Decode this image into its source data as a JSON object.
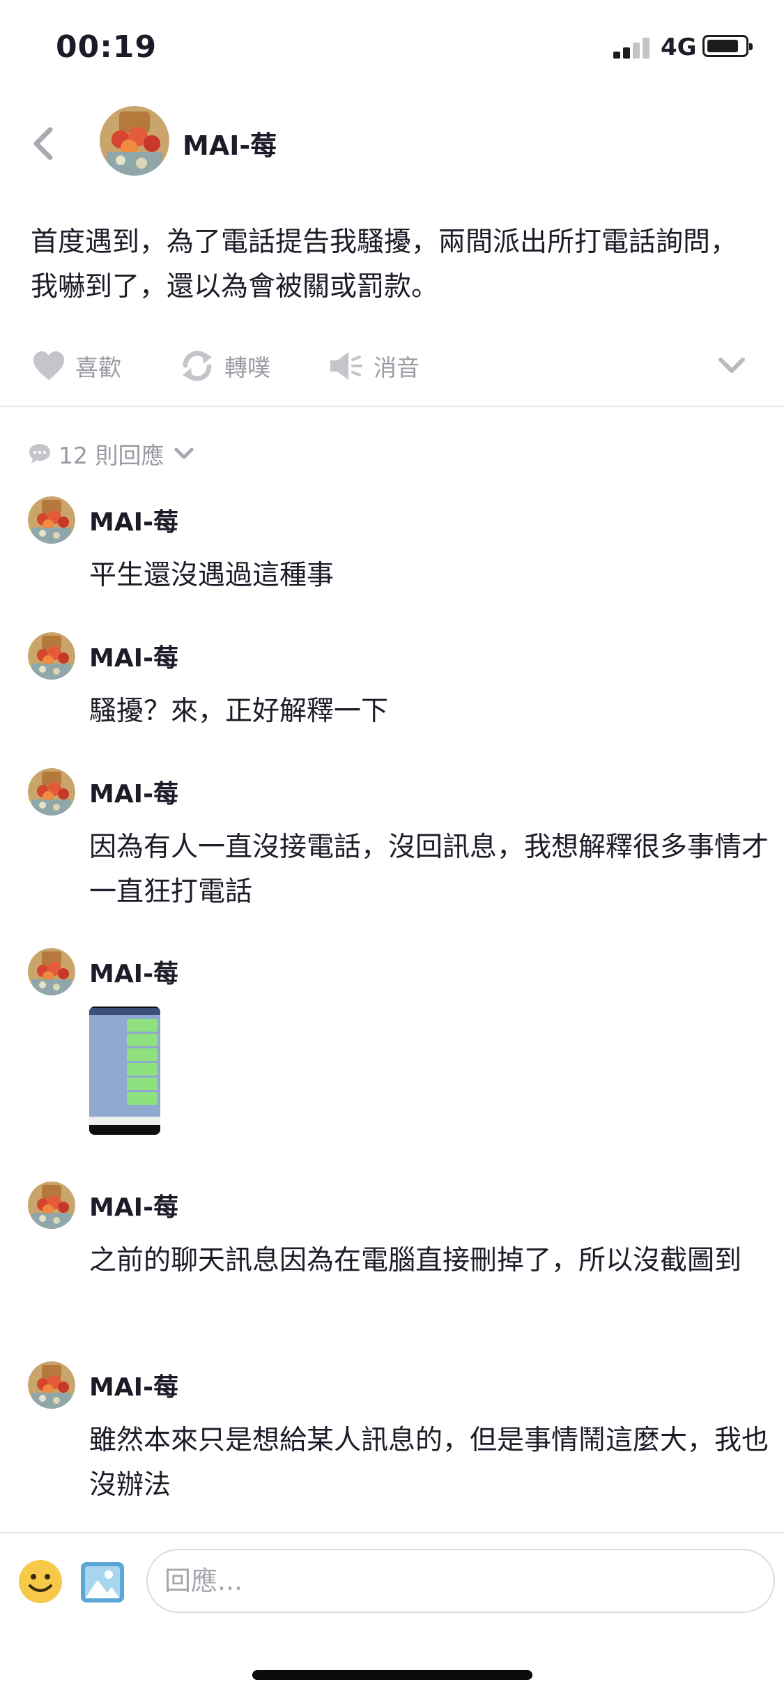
{
  "status_bar": {
    "time": "00:19",
    "network": "4G"
  },
  "header": {
    "name": "MAI-莓"
  },
  "post": {
    "text": "首度遇到，為了電話提告我騷擾，兩間派出所打電話詢問，我嚇到了，還以為會被關或罰款。"
  },
  "actions": {
    "like": "喜歡",
    "repost": "轉噗",
    "mute": "消音"
  },
  "replies": {
    "count_label": "12 則回應"
  },
  "comments": [
    {
      "name": "MAI-莓",
      "text": "平生還沒遇過這種事"
    },
    {
      "name": "MAI-莓",
      "text": "騷擾？來，正好解釋一下"
    },
    {
      "name": "MAI-莓",
      "text": "因為有人一直沒接電話，沒回訊息，我想解釋很多事情才一直狂打電話"
    },
    {
      "name": "MAI-莓",
      "text": ""
    },
    {
      "name": "MAI-莓",
      "text": "之前的聊天訊息因為在電腦直接刪掉了，所以沒截圖到"
    },
    {
      "name": "MAI-莓",
      "text": "雖然本來只是想給某人訊息的，但是事情鬧這麼大，我也沒辦法"
    }
  ],
  "composer": {
    "placeholder": "回應..."
  },
  "icons": {
    "back": "chevron-left-icon",
    "like": "heart-icon",
    "repost": "repost-icon",
    "mute": "speaker-mute-icon",
    "more": "chevron-down-icon",
    "comments": "speech-bubble-icon",
    "emoji": "smiley-icon",
    "image": "image-icon"
  },
  "colors": {
    "accent_gray": "#9a9aa3",
    "text": "#1c1c28",
    "emoji_yellow": "#f7c948",
    "image_blue": "#5aa7d6"
  }
}
